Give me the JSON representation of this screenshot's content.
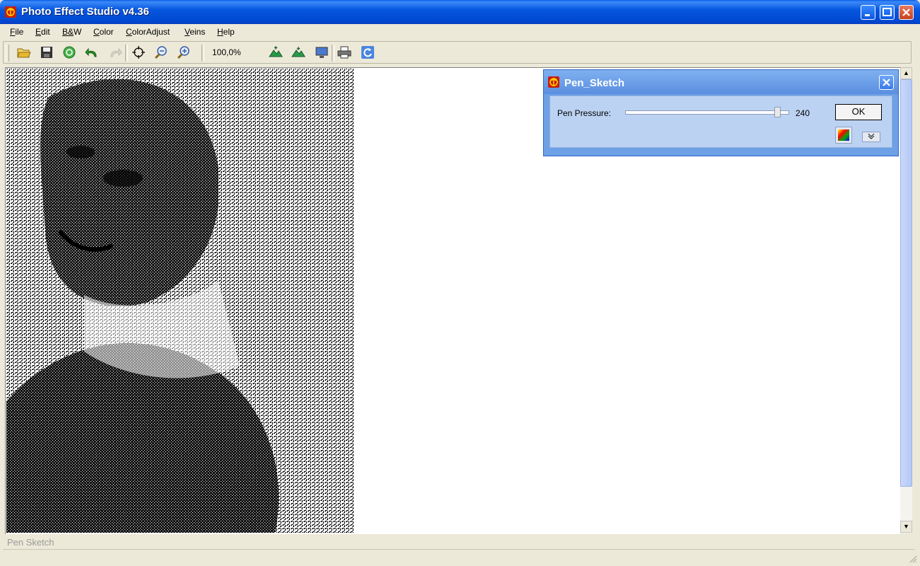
{
  "window": {
    "title": "Photo Effect Studio v4.36"
  },
  "menu": [
    "File",
    "Edit",
    "B&W",
    "Color",
    "ColorAdjust",
    "Veins",
    "Help"
  ],
  "toolbar": {
    "zoom": "100,0%"
  },
  "dialog": {
    "title": "Pen_Sketch",
    "label": "Pen Pressure:",
    "value": "240",
    "ok": "OK"
  },
  "status": {
    "text": "Pen Sketch"
  },
  "colors": {
    "title_blue": "#0757e0",
    "dialog_blue": "#6ea0e5",
    "dialog_body": "#bcd2f2"
  }
}
